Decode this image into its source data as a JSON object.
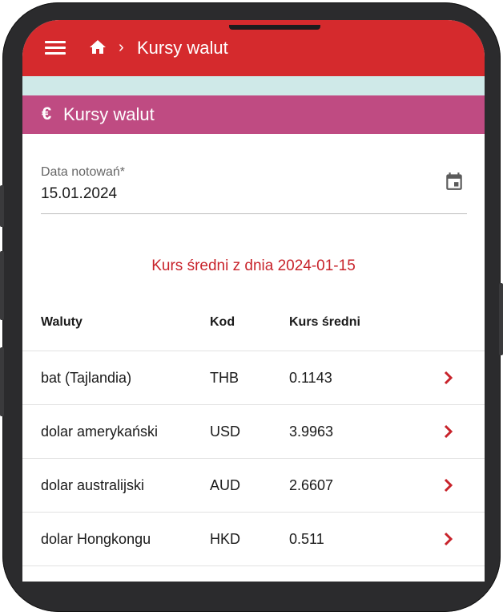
{
  "header": {
    "breadcrumb_separator": "›",
    "title": "Kursy walut",
    "menu_icon": "menu-icon",
    "home_icon": "home-icon",
    "color": "#d52a2d"
  },
  "section": {
    "icon": "€",
    "title": "Kursy walut",
    "color": "#bf4b82"
  },
  "date_field": {
    "label": "Data notowań*",
    "value": "15.01.2024",
    "icon": "calendar-icon"
  },
  "caption": "Kurs średni z dnia 2024-01-15",
  "table": {
    "headers": [
      "Waluty",
      "Kod",
      "Kurs średni"
    ],
    "rows": [
      {
        "name": "bat (Tajlandia)",
        "code": "THB",
        "rate": "0.1143"
      },
      {
        "name": "dolar amerykański",
        "code": "USD",
        "rate": "3.9963"
      },
      {
        "name": "dolar australijski",
        "code": "AUD",
        "rate": "2.6607"
      },
      {
        "name": "dolar Hongkongu",
        "code": "HKD",
        "rate": "0.511"
      }
    ],
    "row_action_icon": "chevron-right-icon"
  }
}
